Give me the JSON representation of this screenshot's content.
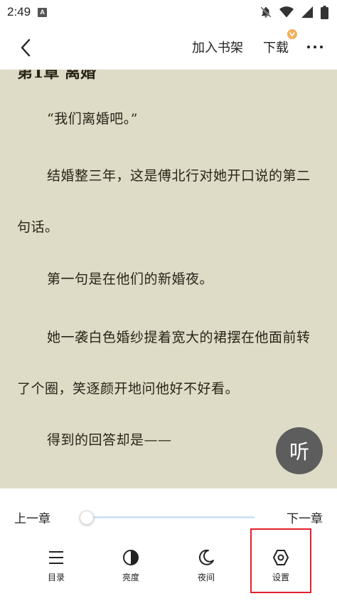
{
  "status_bar": {
    "time": "2:49",
    "app_indicator": "A"
  },
  "top_bar": {
    "add_to_shelf": "加入书架",
    "download": "下载",
    "download_badge_color": "#f1b15b"
  },
  "reader": {
    "chapter_title": "第1章 离婚",
    "paragraphs": [
      "“我们离婚吧。”",
      "结婚整三年，这是傅北行对她开口说的第二句话。",
      "第一句是在他们的新婚夜。",
      "她一袭白色婚纱提着宽大的裙摆在他面前转了个圈，笑逐颜开地问他好不好看。",
      "得到的回答却是——"
    ],
    "background_color": "#dedcc7",
    "listen_button": "听"
  },
  "bottom_menu": {
    "prev_chapter": "上一章",
    "next_chapter": "下一章",
    "progress": 0.04,
    "tools": {
      "toc": "目录",
      "brightness": "亮度",
      "night": "夜间",
      "settings": "设置"
    },
    "highlighted_tool": "settings",
    "highlight_color": "#e5202a"
  }
}
